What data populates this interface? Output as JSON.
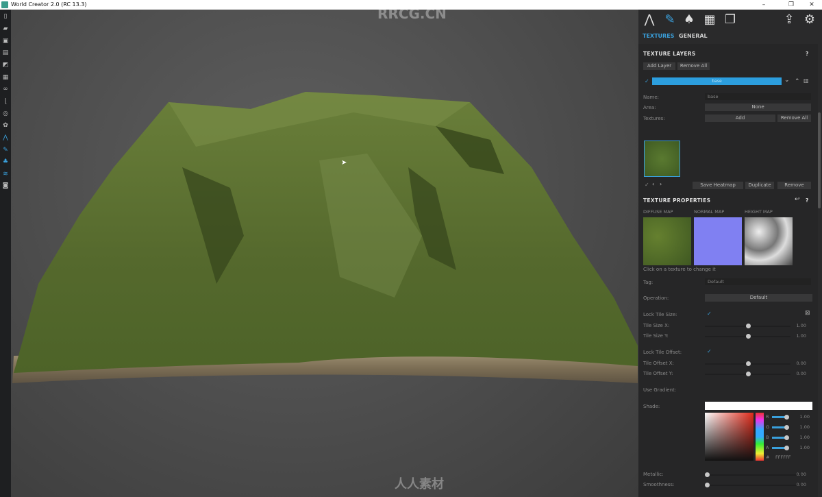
{
  "window": {
    "title": "World Creator 2.0 (RC 13.3)",
    "controls": [
      "–",
      "❐",
      "✕"
    ]
  },
  "watermarks": {
    "top": "RRCG.CN",
    "bottom": "人人素材"
  },
  "toolbar": {
    "icons": [
      "new-file-icon",
      "open-folder-icon",
      "save-icon",
      "save-as-icon",
      "import-icon",
      "map-icon",
      "binoculars-icon",
      "brush-tool-icon",
      "compass-icon",
      "stamp-icon",
      "terrain-icon",
      "paint-icon",
      "vegetation-icon",
      "water-icon",
      "camera-icon"
    ]
  },
  "panel": {
    "top_icons": [
      "terrain-icon",
      "paintbrush-icon",
      "trees-icon",
      "map-icon",
      "layers-icon",
      "export-icon",
      "settings-icon"
    ],
    "tabs": [
      "TEXTURES",
      "GENERAL"
    ],
    "texture_layers": {
      "title": "TEXTURE LAYERS",
      "help": "?",
      "add_layer": "Add Layer",
      "remove_all": "Remove All",
      "layer_name": "base",
      "name_label": "Name:",
      "name_value": "base",
      "area_label": "Area:",
      "area_value": "None",
      "textures_label": "Textures:",
      "add": "Add",
      "textures_remove_all": "Remove All",
      "save_heatmap": "Save Heatmap",
      "duplicate": "Duplicate",
      "remove": "Remove"
    },
    "texture_properties": {
      "title": "TEXTURE PROPERTIES",
      "help": "?",
      "diffuse": "DIFFUSE MAP",
      "normal": "NORMAL MAP",
      "height": "HEIGHT MAP",
      "hint": "Click on a texture to change it",
      "tag_label": "Tag:",
      "tag_value": "Default",
      "operation_label": "Operation:",
      "operation_value": "Default",
      "lock_tile_size": "Lock Tile Size:",
      "tile_size_x": "Tile Size X:",
      "tile_size_x_val": "1.00",
      "tile_size_y": "Tile Size Y:",
      "tile_size_y_val": "1.00",
      "lock_tile_offset": "Lock Tile Offset:",
      "tile_offset_x": "Tile Offset X:",
      "tile_offset_x_val": "0.00",
      "tile_offset_y": "Tile Offset Y:",
      "tile_offset_y_val": "0.00",
      "use_gradient": "Use Gradient:",
      "shade": "Shade:",
      "rgba": [
        {
          "k": "R",
          "v": "1.00"
        },
        {
          "k": "G",
          "v": "1.00"
        },
        {
          "k": "B",
          "v": "1.00"
        },
        {
          "k": "A",
          "v": "1.00"
        }
      ],
      "hash": "#",
      "hex": "FFFFFF",
      "metallic": "Metallic:",
      "metallic_val": "0.00",
      "smoothness": "Smoothness:",
      "smoothness_val": "0.00"
    }
  },
  "colors": {
    "accent": "#3aa0dc",
    "panel": "#2a2a2b"
  }
}
